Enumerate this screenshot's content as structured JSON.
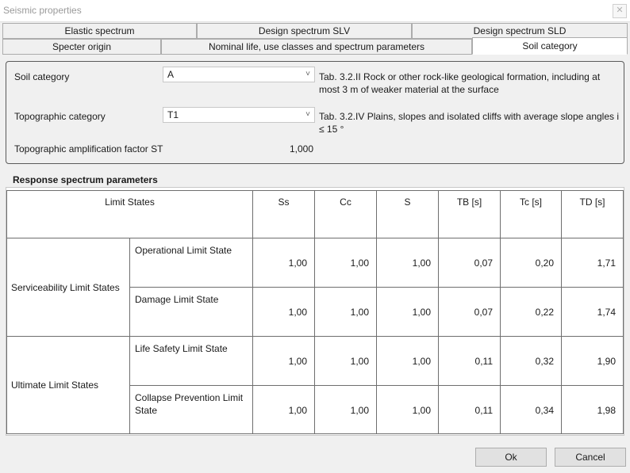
{
  "window": {
    "title": "Seismic properties",
    "close_icon": "close-icon"
  },
  "tabs_row1": [
    "Elastic spectrum",
    "Design spectrum SLV",
    "Design spectrum SLD"
  ],
  "tabs_row2": [
    "Specter origin",
    "Nominal life, use classes and spectrum parameters",
    "Soil category"
  ],
  "active_tab": "Soil category",
  "soil": {
    "soil_label": "Soil category",
    "soil_value": "A",
    "soil_desc": "Tab. 3.2.II Rock or other rock-like geological formation, including at most 3 m of weaker material at the surface",
    "topo_label": "Topographic category",
    "topo_value": "T1",
    "topo_desc": "Tab. 3.2.IV Plains, slopes and isolated cliffs with average slope angles i ≤ 15 °",
    "amp_label": "Topographic amplification factor ST",
    "amp_value": "1,000"
  },
  "response": {
    "title": "Response spectrum parameters",
    "headers": [
      "Limit States",
      "Ss",
      "Cc",
      "S",
      "TB [s]",
      "Tc [s]",
      "TD [s]"
    ],
    "groups": [
      {
        "label": "Serviceability Limit States",
        "rows": [
          {
            "label": "Operational Limit State",
            "values": [
              "1,00",
              "1,00",
              "1,00",
              "0,07",
              "0,20",
              "1,71"
            ]
          },
          {
            "label": "Damage Limit State",
            "values": [
              "1,00",
              "1,00",
              "1,00",
              "0,07",
              "0,22",
              "1,74"
            ]
          }
        ]
      },
      {
        "label": "Ultimate Limit States",
        "rows": [
          {
            "label": "Life Safety Limit State",
            "values": [
              "1,00",
              "1,00",
              "1,00",
              "0,11",
              "0,32",
              "1,90"
            ]
          },
          {
            "label": "Collapse Prevention Limit State",
            "values": [
              "1,00",
              "1,00",
              "1,00",
              "0,11",
              "0,34",
              "1,98"
            ]
          }
        ]
      }
    ]
  },
  "buttons": {
    "ok": "Ok",
    "cancel": "Cancel"
  }
}
